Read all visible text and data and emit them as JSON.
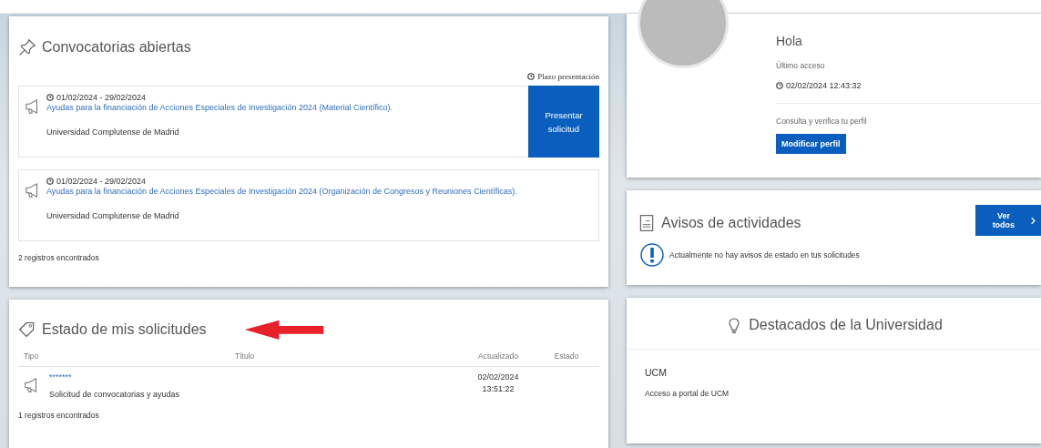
{
  "convocatorias": {
    "title": "Convocatorias abiertas",
    "deadline_label": "Plazo presentación",
    "items": [
      {
        "dates": "01/02/2024 - 29/02/2024",
        "title": "Ayudas para la financiación de Acciones Especiales de Investigación 2024 (Material Científico).",
        "org": "Universidad Complutense de Madrid",
        "button": "Presentar solicitud"
      },
      {
        "dates": "01/02/2024 - 29/02/2024",
        "title": "Ayudas para la financiación de Acciones Especiales de Investigación 2024 (Organización de Congresos y Reuniones Científicas).",
        "org": "Universidad Complutense de Madrid"
      }
    ],
    "count": "2 registros encontrados"
  },
  "solicitudes": {
    "title": "Estado de mis solicitudes",
    "columns": [
      "Tipo",
      "Título",
      "Actualizado",
      "Estado"
    ],
    "rows": [
      {
        "code": "*******",
        "title": "Solicitud de convocatorias y ayudas",
        "updated": "02/02/2024\n13:51:22"
      }
    ],
    "count": "1 registros encontrados"
  },
  "profile": {
    "greeting": "Hola",
    "last_access_label": "Último acceso",
    "last_access": "02/02/2024 12:43:32",
    "verify_label": "Consulta y verifica tu perfil",
    "button": "Modificar perfil"
  },
  "avisos": {
    "title": "Avisos de actividades",
    "button": "Ver todos",
    "message": "Actualmente no hay avisos de estado en tus solicitudes"
  },
  "destacados": {
    "title": "Destacados de la Universidad",
    "items": [
      {
        "title": "UCM",
        "text": "Acceso a portal de UCM"
      }
    ]
  }
}
